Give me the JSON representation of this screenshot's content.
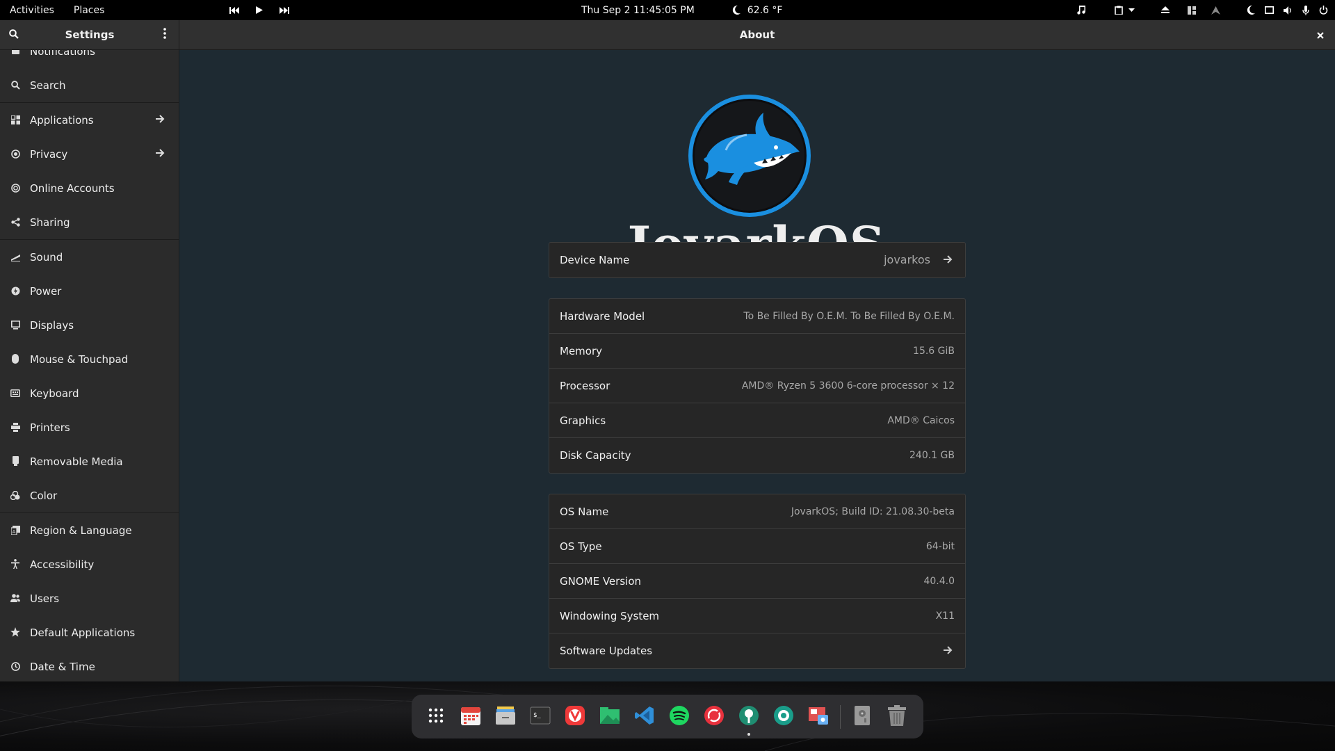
{
  "topbar": {
    "activities": "Activities",
    "places": "Places",
    "clock": "Thu Sep 2  11:45:05 PM",
    "temperature": "62.6 °F"
  },
  "settings": {
    "sidebar_title": "Settings",
    "page_title": "About",
    "sidebar_items": [
      {
        "label": "Notifications",
        "icon": "bell-icon"
      },
      {
        "label": "Search",
        "icon": "search-icon"
      },
      {
        "label": "Applications",
        "icon": "apps-grid-icon",
        "arrow": true
      },
      {
        "label": "Privacy",
        "icon": "privacy-icon",
        "arrow": true
      },
      {
        "label": "Online Accounts",
        "icon": "online-accounts-icon"
      },
      {
        "label": "Sharing",
        "icon": "share-icon"
      },
      {
        "label": "Sound",
        "icon": "sound-icon"
      },
      {
        "label": "Power",
        "icon": "power-icon"
      },
      {
        "label": "Displays",
        "icon": "display-icon"
      },
      {
        "label": "Mouse & Touchpad",
        "icon": "mouse-icon"
      },
      {
        "label": "Keyboard",
        "icon": "keyboard-icon"
      },
      {
        "label": "Printers",
        "icon": "printer-icon"
      },
      {
        "label": "Removable Media",
        "icon": "usb-icon"
      },
      {
        "label": "Color",
        "icon": "color-icon"
      },
      {
        "label": "Region & Language",
        "icon": "region-icon"
      },
      {
        "label": "Accessibility",
        "icon": "accessibility-icon"
      },
      {
        "label": "Users",
        "icon": "users-icon"
      },
      {
        "label": "Default Applications",
        "icon": "star-icon"
      },
      {
        "label": "Date & Time",
        "icon": "clock-icon"
      }
    ]
  },
  "about": {
    "brand": "JovarkOS",
    "device": {
      "label": "Device Name",
      "value": "jovarkos"
    },
    "hardware": [
      {
        "label": "Hardware Model",
        "value": "To Be Filled By O.E.M. To Be Filled By O.E.M."
      },
      {
        "label": "Memory",
        "value": "15.6 GiB"
      },
      {
        "label": "Processor",
        "value": "AMD® Ryzen 5 3600 6-core processor × 12"
      },
      {
        "label": "Graphics",
        "value": "AMD® Caicos"
      },
      {
        "label": "Disk Capacity",
        "value": "240.1 GB"
      }
    ],
    "software": [
      {
        "label": "OS Name",
        "value": "JovarkOS; Build ID: 21.08.30-beta"
      },
      {
        "label": "OS Type",
        "value": "64-bit"
      },
      {
        "label": "GNOME Version",
        "value": "40.4.0"
      },
      {
        "label": "Windowing System",
        "value": "X11"
      },
      {
        "label": "Software Updates",
        "value": ""
      }
    ]
  },
  "dock": {
    "apps": [
      "app-grid-icon",
      "calendar-icon",
      "files-icon",
      "terminal-icon",
      "vivaldi-icon",
      "photos-icon",
      "vscode-icon",
      "spotify-icon",
      "creative-cloud-icon",
      "pamac-icon",
      "shutter-icon",
      "screenshot-icon",
      "drive-icon",
      "trash-icon"
    ]
  }
}
